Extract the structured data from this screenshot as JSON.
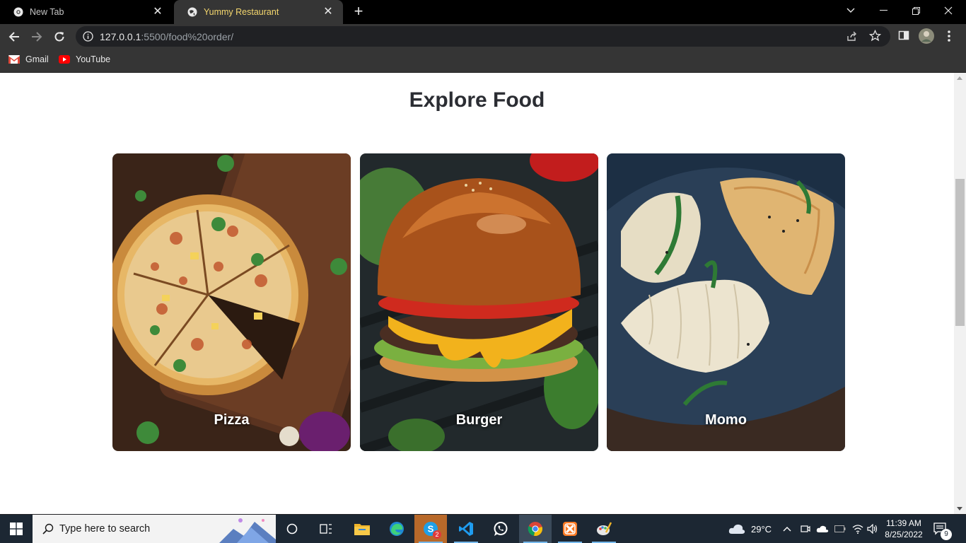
{
  "browser": {
    "tabs": [
      {
        "title": "New Tab",
        "active": false
      },
      {
        "title": "Yummy Restaurant",
        "active": true
      }
    ],
    "url_host": "127.0.0.1",
    "url_path": ":5500/food%20order/",
    "bookmarks": [
      {
        "label": "Gmail"
      },
      {
        "label": "YouTube"
      }
    ]
  },
  "page": {
    "section_title": "Explore Food",
    "foods": [
      {
        "name": "Pizza"
      },
      {
        "name": "Burger"
      },
      {
        "name": "Momo"
      }
    ]
  },
  "taskbar": {
    "search_placeholder": "Type here to search",
    "weather_temp": "29°C",
    "time": "11:39 AM",
    "date": "8/25/2022",
    "notification_count": "9",
    "skype_badge": "2"
  },
  "colors": {
    "tab_active_text": "#f5d76e",
    "page_background": "#ffffff",
    "title_color": "#2b2d33",
    "taskbar_background": "#1c2733"
  }
}
